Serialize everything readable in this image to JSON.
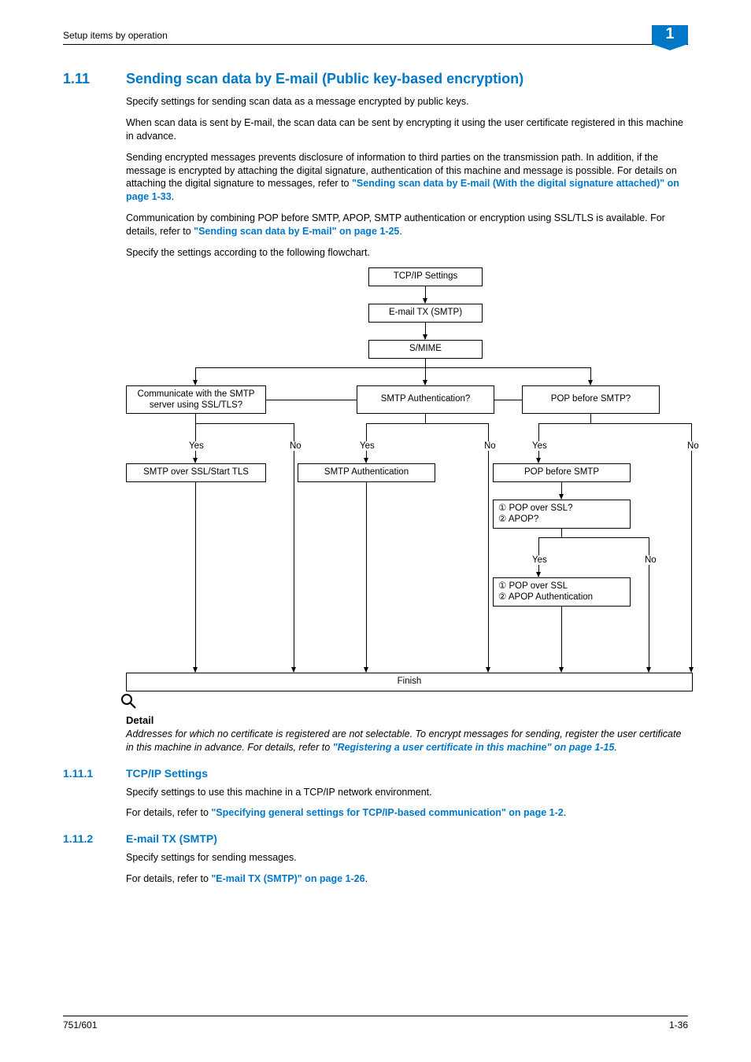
{
  "header": {
    "breadcrumb": "Setup items by operation",
    "chapter": "1"
  },
  "section": {
    "number": "1.11",
    "title": "Sending scan data by E-mail (Public key-based encryption)",
    "p1": "Specify settings for sending scan data as a message encrypted by public keys.",
    "p2": "When scan data is sent by E-mail, the scan data can be sent by encrypting it using the user certificate registered in this machine in advance.",
    "p3a": "Sending encrypted messages prevents disclosure of information to third parties on the transmission path. In addition, if the message is encrypted by attaching the digital signature, authentication of this machine and message is possible. For details on attaching the digital signature to messages, refer to ",
    "p3link": "\"Sending scan data by E-mail (With the digital signature attached)\" on page 1-33",
    "p3b": ".",
    "p4a": "Communication by combining POP before SMTP, APOP, SMTP authentication or encryption using SSL/TLS is available. For details, refer to ",
    "p4link": "\"Sending scan data by E-mail\" on page 1-25",
    "p4b": ".",
    "p5": "Specify the settings according to the following flowchart."
  },
  "chart_data": {
    "type": "flowchart",
    "nodes": {
      "tcpip": "TCP/IP Settings",
      "smtp": "E-mail TX (SMTP)",
      "smime": "S/MIME",
      "ssl_q": "Communicate with the SMTP server using SSL/TLS?",
      "auth_q": "SMTP Authentication?",
      "pop_q": "POP before SMTP?",
      "ssl_a": "SMTP over SSL/Start TLS",
      "auth_a": "SMTP Authentication",
      "pop_a": "POP before SMTP",
      "pop2_q_l1": "① POP over SSL?",
      "pop2_q_l2": "② APOP?",
      "pop2_a_l1": "① POP over SSL",
      "pop2_a_l2": "② APOP Authentication",
      "finish": "Finish"
    },
    "labels": {
      "yes": "Yes",
      "no": "No"
    },
    "edges": [
      [
        "tcpip",
        "smtp"
      ],
      [
        "smtp",
        "smime"
      ],
      [
        "smime",
        "ssl_q"
      ],
      [
        "smime",
        "auth_q"
      ],
      [
        "smime",
        "pop_q"
      ],
      [
        "ssl_q",
        "Yes",
        "ssl_a"
      ],
      [
        "ssl_q",
        "No",
        "finish"
      ],
      [
        "auth_q",
        "Yes",
        "auth_a"
      ],
      [
        "auth_q",
        "No",
        "finish"
      ],
      [
        "pop_q",
        "Yes",
        "pop_a"
      ],
      [
        "pop_q",
        "No",
        "finish"
      ],
      [
        "pop_a",
        "pop2_q"
      ],
      [
        "pop2_q",
        "Yes",
        "pop2_a"
      ],
      [
        "pop2_q",
        "No",
        "finish"
      ],
      [
        "ssl_a",
        "finish"
      ],
      [
        "auth_a",
        "finish"
      ],
      [
        "pop2_a",
        "finish"
      ]
    ]
  },
  "detail": {
    "label": "Detail",
    "text_a": "Addresses for which no certificate is registered are not selectable. To encrypt messages for sending, register the user certificate in this machine in advance. For details, refer to ",
    "link": "\"Registering a user certificate in this machine\" on page 1-15",
    "text_b": "."
  },
  "sub1": {
    "number": "1.11.1",
    "title": "TCP/IP Settings",
    "p1": "Specify settings to use this machine in a TCP/IP network environment.",
    "p2a": "For details, refer to ",
    "p2link": "\"Specifying general settings for TCP/IP-based communication\" on page 1-2",
    "p2b": "."
  },
  "sub2": {
    "number": "1.11.2",
    "title": "E-mail TX (SMTP)",
    "p1": "Specify settings for sending messages.",
    "p2a": "For details, refer to ",
    "p2link": "\"E-mail TX (SMTP)\" on page 1-26",
    "p2b": "."
  },
  "footer": {
    "left": "751/601",
    "right": "1-36"
  }
}
